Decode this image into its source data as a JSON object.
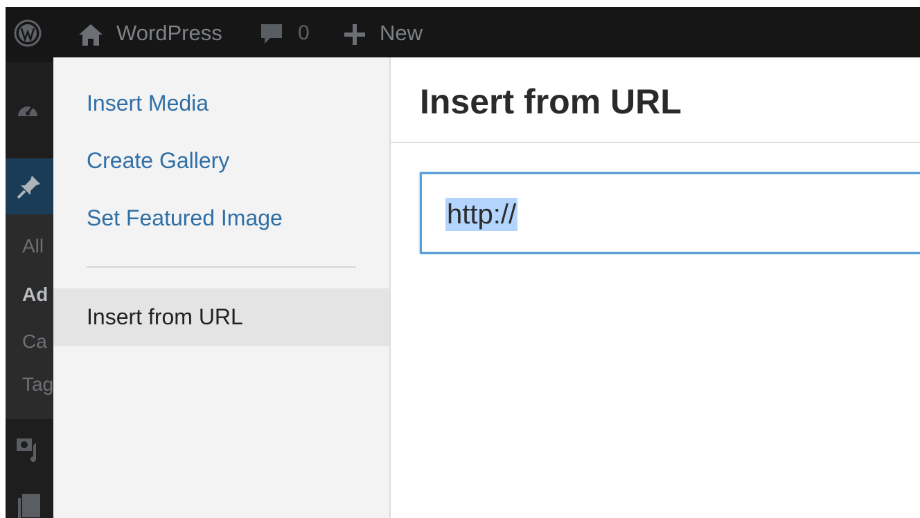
{
  "adminbar": {
    "site_name": "WordPress",
    "comment_count": "0",
    "new_label": "New",
    "icons": [
      "wordpress-logo-icon",
      "home-icon",
      "comment-icon",
      "plus-icon"
    ]
  },
  "adminmenu": {
    "submenu_items": [
      "All",
      "Ad",
      "Ca",
      "Tag"
    ],
    "icons": [
      "dashboard-icon",
      "pin-icon",
      "media-icon",
      "pages-icon"
    ]
  },
  "media_menu": {
    "items": [
      {
        "label": "Insert Media"
      },
      {
        "label": "Create Gallery"
      },
      {
        "label": "Set Featured Image"
      }
    ],
    "active_item": "Insert from URL"
  },
  "frame": {
    "title": "Insert from URL"
  },
  "url_field": {
    "value": "http://"
  },
  "colors": {
    "adminbar_bg": "#161616",
    "link": "#2f6fa6",
    "input_focus_border": "#5b9dd9",
    "selection": "#b3d4fc"
  }
}
